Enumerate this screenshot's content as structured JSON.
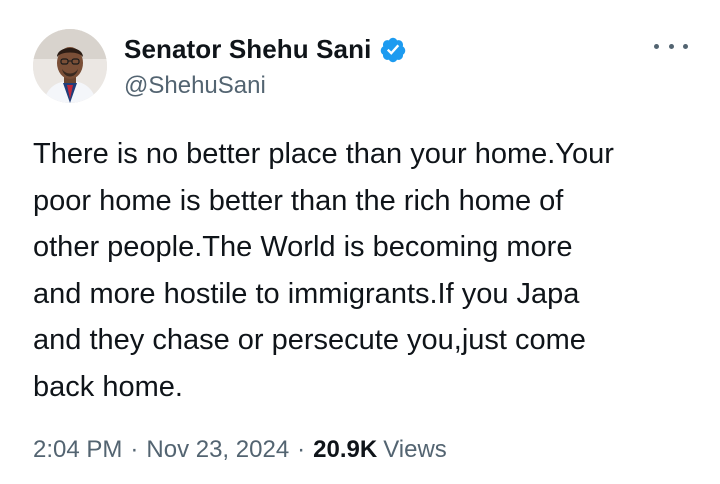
{
  "author": {
    "display_name": "Senator Shehu Sani",
    "handle": "@ShehuSani",
    "verified": true,
    "verified_color": "#1d9bf0"
  },
  "tweet": {
    "text": "There is no better place than your home.Your\npoor home is better than the rich home of\nother people.The World is becoming more\nand more hostile to immigrants.If you Japa\nand they chase or persecute you,just come\nback home."
  },
  "meta": {
    "time": "2:04 PM",
    "separator": "·",
    "date": "Nov 23, 2024",
    "views_count": "20.9K",
    "views_label": "Views"
  },
  "icons": {
    "more": "more-horizontal-icon",
    "verified": "verified-badge-icon"
  },
  "colors": {
    "text_primary": "#0f1419",
    "text_secondary": "#536471",
    "accent": "#1d9bf0"
  }
}
